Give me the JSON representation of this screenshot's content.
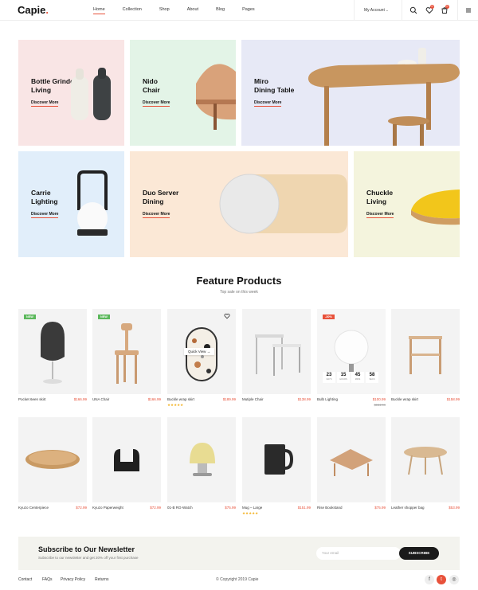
{
  "header": {
    "logo": "Capie",
    "nav": [
      "Home",
      "Collection",
      "Shop",
      "About",
      "Blog",
      "Pages"
    ],
    "account": "My Account",
    "wishlist_count": "0",
    "cart_count": "0"
  },
  "categories": [
    {
      "title": "Bottle Grinder\nLiving",
      "link": "Discover More",
      "bg": "#f9e5e5"
    },
    {
      "title": "Nido\nChair",
      "link": "Discover More",
      "bg": "#e3f4e7"
    },
    {
      "title": "Miro\nDining Table",
      "link": "Discover More",
      "bg": "#e7e9f6"
    },
    {
      "title": "Carrie\nLighting",
      "link": "Discover More",
      "bg": "#e1eefa"
    },
    {
      "title": "Duo Server\nDining",
      "link": "Discover More",
      "bg": "#fbe8d6"
    },
    {
      "title": "Chuckle\nLiving",
      "link": "Discover More",
      "bg": "#f4f4dd"
    }
  ],
  "feature": {
    "title": "Feature Products",
    "subtitle": "Top sale on this week",
    "quick_view": "Quick View",
    "countdown": [
      {
        "value": "23",
        "unit": "DAYS"
      },
      {
        "value": "15",
        "unit": "HOURS"
      },
      {
        "value": "45",
        "unit": "MINS"
      },
      {
        "value": "58",
        "unit": "SECS"
      }
    ],
    "products": [
      {
        "name": "Pocket 6een skirt",
        "price": "$166.99",
        "tag": "NEW",
        "tag_color": "#5cb85c"
      },
      {
        "name": "UNA Chair",
        "price": "$166.99",
        "tag": "NEW",
        "tag_color": "#5cb85c"
      },
      {
        "name": "Buckle wrap skirt",
        "price": "$189.99",
        "stars": "★★★★★"
      },
      {
        "name": "Mutiple Chair",
        "price": "$138.99"
      },
      {
        "name": "Bulb Lighting",
        "price": "$100.99",
        "old_price": "$154.99",
        "tag": "-30%",
        "tag_color": "#e8513a"
      },
      {
        "name": "Buckle wrap skirt",
        "price": "$158.99"
      },
      {
        "name": "Kyuzo Centerpiece",
        "price": "$72.99"
      },
      {
        "name": "Kyuzo Paperweight",
        "price": "$72.99"
      },
      {
        "name": "01-B RG-Watch",
        "price": "$75.99"
      },
      {
        "name": "Mug – Large",
        "price": "$151.99",
        "stars": "★★★★★"
      },
      {
        "name": "Rise Bookstand",
        "price": "$75.99"
      },
      {
        "name": "Leather shopper bag",
        "price": "$53.99"
      }
    ]
  },
  "newsletter": {
    "title": "Subscribe to Our Newsletter",
    "subtitle": "Subscribe to our newsletter and get 20% off your first purchase",
    "placeholder": "Your email",
    "button": "SUBSCRIBE"
  },
  "footer": {
    "links": [
      "Contact",
      "FAQs",
      "Privacy Policy",
      "Returns"
    ],
    "copyright": "© Copyright 2019 Capie",
    "social": [
      "facebook-icon",
      "twitter-icon",
      "instagram-icon"
    ]
  },
  "colors": {
    "accent": "#e8513a",
    "dark": "#1a1a1a"
  }
}
